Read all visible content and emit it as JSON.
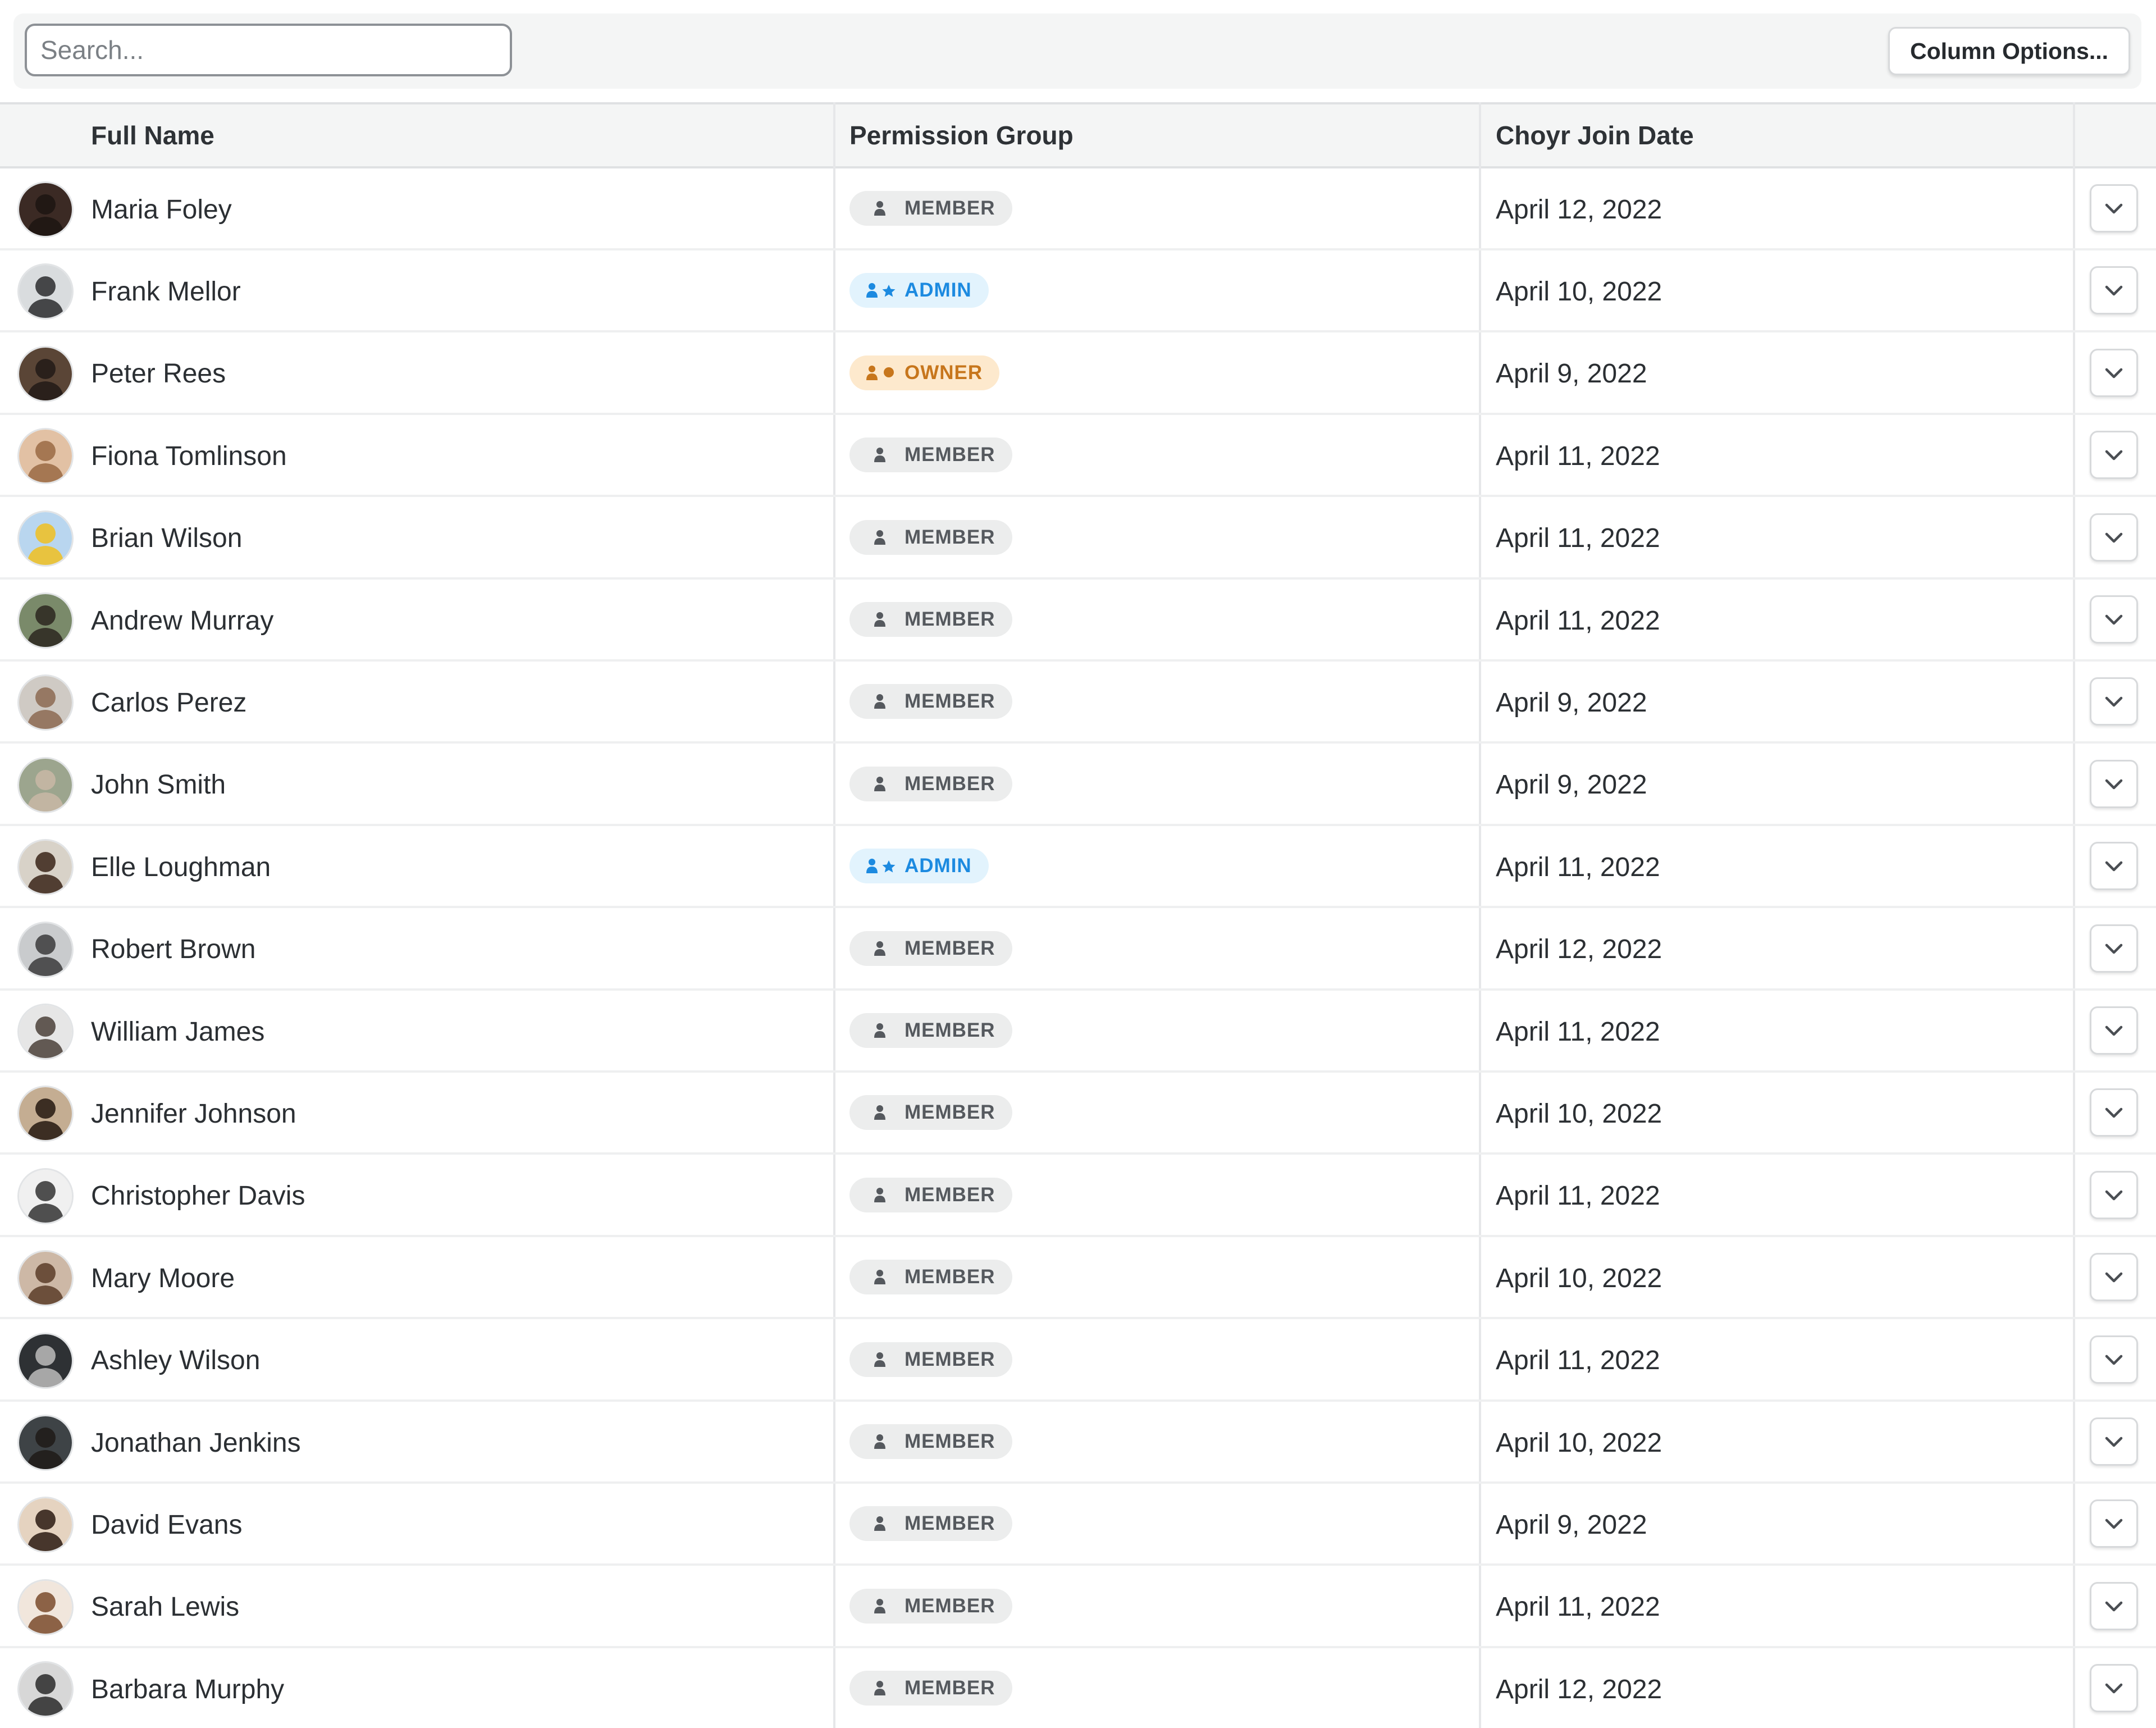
{
  "toolbar": {
    "search_placeholder": "Search...",
    "column_options_label": "Column Options..."
  },
  "table": {
    "columns": [
      "Full Name",
      "Permission Group",
      "Choyr Join Date"
    ],
    "rows": [
      {
        "name": "Maria Foley",
        "group": "MEMBER",
        "date": "April 12, 2022"
      },
      {
        "name": "Frank Mellor",
        "group": "ADMIN",
        "date": "April 10, 2022"
      },
      {
        "name": "Peter Rees",
        "group": "OWNER",
        "date": "April 9, 2022"
      },
      {
        "name": "Fiona Tomlinson",
        "group": "MEMBER",
        "date": "April 11, 2022"
      },
      {
        "name": "Brian Wilson",
        "group": "MEMBER",
        "date": "April 11, 2022"
      },
      {
        "name": "Andrew Murray",
        "group": "MEMBER",
        "date": "April 11, 2022"
      },
      {
        "name": "Carlos Perez",
        "group": "MEMBER",
        "date": "April 9, 2022"
      },
      {
        "name": "John Smith",
        "group": "MEMBER",
        "date": "April 9, 2022"
      },
      {
        "name": "Elle Loughman",
        "group": "ADMIN",
        "date": "April 11, 2022"
      },
      {
        "name": "Robert Brown",
        "group": "MEMBER",
        "date": "April 12, 2022"
      },
      {
        "name": "William James",
        "group": "MEMBER",
        "date": "April 11, 2022"
      },
      {
        "name": "Jennifer Johnson",
        "group": "MEMBER",
        "date": "April 10, 2022"
      },
      {
        "name": "Christopher Davis",
        "group": "MEMBER",
        "date": "April 11, 2022"
      },
      {
        "name": "Mary Moore",
        "group": "MEMBER",
        "date": "April 10, 2022"
      },
      {
        "name": "Ashley Wilson",
        "group": "MEMBER",
        "date": "April 11, 2022"
      },
      {
        "name": "Jonathan Jenkins",
        "group": "MEMBER",
        "date": "April 10, 2022"
      },
      {
        "name": "David Evans",
        "group": "MEMBER",
        "date": "April 9, 2022"
      },
      {
        "name": "Sarah Lewis",
        "group": "MEMBER",
        "date": "April 11, 2022"
      },
      {
        "name": "Barbara Murphy",
        "group": "MEMBER",
        "date": "April 12, 2022"
      }
    ]
  },
  "icons": {
    "member": "person-icon",
    "admin": "person-star-icon",
    "owner": "person-crown-icon",
    "expand": "chevron-down-icon",
    "avatar": "avatar-photo"
  },
  "colors": {
    "member_bg": "#eceded",
    "member_fg": "#55595e",
    "admin_bg": "#e2f3fd",
    "admin_fg": "#1c8ae0",
    "owner_bg": "#fde9cd",
    "owner_fg": "#c7761c"
  }
}
